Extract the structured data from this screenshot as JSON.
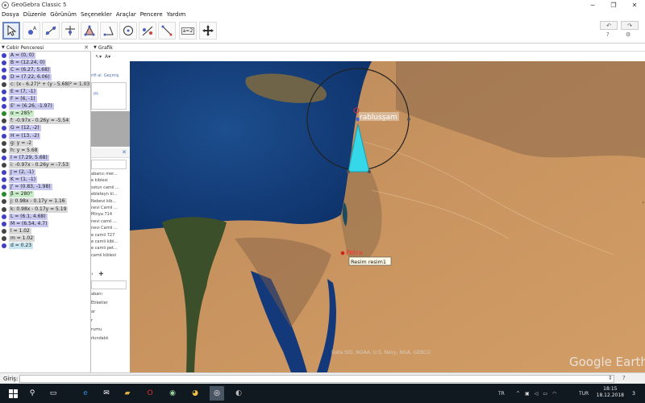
{
  "window": {
    "title": "GeoGebra Classic 5"
  },
  "menu": [
    "Dosya",
    "Düzenle",
    "Görünüm",
    "Seçenekler",
    "Araçlar",
    "Pencere",
    "Yardım"
  ],
  "toolbar": {
    "slider_label": "a=2"
  },
  "algebra": {
    "title": "Cebir Penceresi",
    "rows": [
      {
        "text": "A = (0, 0)",
        "dot": "#4040c0",
        "bg": "#c8c8f0"
      },
      {
        "text": "B = (12.24, 0)",
        "dot": "#4040c0",
        "bg": "#c8c8f0"
      },
      {
        "text": "C = (6.27, 5.68)",
        "dot": "#4040c0",
        "bg": "#c8c8f0"
      },
      {
        "text": "D = (7.22, 6.06)",
        "dot": "#4040c0",
        "bg": "#c8c8f0"
      },
      {
        "text": "c: (x - 6.27)² + (y - 5.68)² = 1.03",
        "dot": "#444444",
        "bg": "#d8d8d8"
      },
      {
        "text": "E = (7, -1)",
        "dot": "#4040c0",
        "bg": "#c8c8f0"
      },
      {
        "text": "F = (6, -1)",
        "dot": "#4040c0",
        "bg": "#c8c8f0"
      },
      {
        "text": "E' = (6.26, -1.97)",
        "dot": "#4040c0",
        "bg": "#c8c8f0"
      },
      {
        "text": "α = 285°",
        "dot": "#2a8a2a",
        "bg": "#c8ecc8"
      },
      {
        "text": "f: -0.97x - 0.26y = -5.54",
        "dot": "#444444",
        "bg": "#d8d8d8"
      },
      {
        "text": "G = (12, -2)",
        "dot": "#4040c0",
        "bg": "#c8c8f0"
      },
      {
        "text": "H = (13, -2)",
        "dot": "#4040c0",
        "bg": "#c8c8f0"
      },
      {
        "text": "g: y = -2",
        "dot": "#444444",
        "bg": "#d8d8d8"
      },
      {
        "text": "h: y = 5.68",
        "dot": "#444444",
        "bg": "#d8d8d8"
      },
      {
        "text": "I = (7.29, 5.68)",
        "dot": "#4040c0",
        "bg": "#c8c8f0"
      },
      {
        "text": "i: -0.97x - 0.26y = -7.53",
        "dot": "#444444",
        "bg": "#d8d8d8"
      },
      {
        "text": "J = (2, -1)",
        "dot": "#4040c0",
        "bg": "#c8c8f0"
      },
      {
        "text": "K = (1, -1)",
        "dot": "#4040c0",
        "bg": "#c8c8f0"
      },
      {
        "text": "J' = (0.83, -1.98)",
        "dot": "#4040c0",
        "bg": "#c8c8f0"
      },
      {
        "text": "β = 280°",
        "dot": "#2a8a2a",
        "bg": "#c8ecc8"
      },
      {
        "text": "j: 0.98x - 0.17y = 1.16",
        "dot": "#444444",
        "bg": "#d8d8d8"
      },
      {
        "text": "k: 0.98x - 0.17y = 5.19",
        "dot": "#444444",
        "bg": "#d8d8d8"
      },
      {
        "text": "L = (6.1, 4.68)",
        "dot": "#4040c0",
        "bg": "#c8c8f0"
      },
      {
        "text": "M = (6.54, 4.7)",
        "dot": "#4040c0",
        "bg": "#c8c8f0"
      },
      {
        "text": "l = 1.02",
        "dot": "#444444",
        "bg": "#d8d8d8"
      },
      {
        "text": "m = 1.02",
        "dot": "#444444",
        "bg": "#d8d8d8"
      },
      {
        "text": "d = 0.23",
        "dot": "#4040c0",
        "bg": "#c8e6f0"
      }
    ]
  },
  "behind_panel": {
    "tabs": [
      "rifi al",
      "Geçmiş"
    ],
    "snippets": [
      "m",
      "abancı mer...",
      "e kiblesi",
      "sstun camii ...",
      "ebleteyn ki...",
      "Nebevi kib...",
      "nevi Camii ...",
      "Minya 714",
      "nevi camii ...",
      "nevi Camii ...",
      "e camii 727",
      "e camii kibl...",
      "e camii pet...",
      "camii kiblesi",
      "abanı",
      "Etiketler",
      "ar",
      "r",
      "rumu",
      "rkındalık"
    ]
  },
  "graphics": {
    "title": "Grafik",
    "style_label": "A▾",
    "labels": {
      "city": "rablusşam",
      "petra": "Petra",
      "image": "Resim resim1",
      "watermark": "Google Earth",
      "attribution": "Data SIO, NOAA, U.S. Navy, NGA, GEBCO"
    }
  },
  "input": {
    "label": "Giriş:"
  },
  "taskbar": {
    "lang": "TR",
    "kbd": "TUR",
    "time": "18:15",
    "date": "18.12.2018",
    "notif": "3"
  }
}
